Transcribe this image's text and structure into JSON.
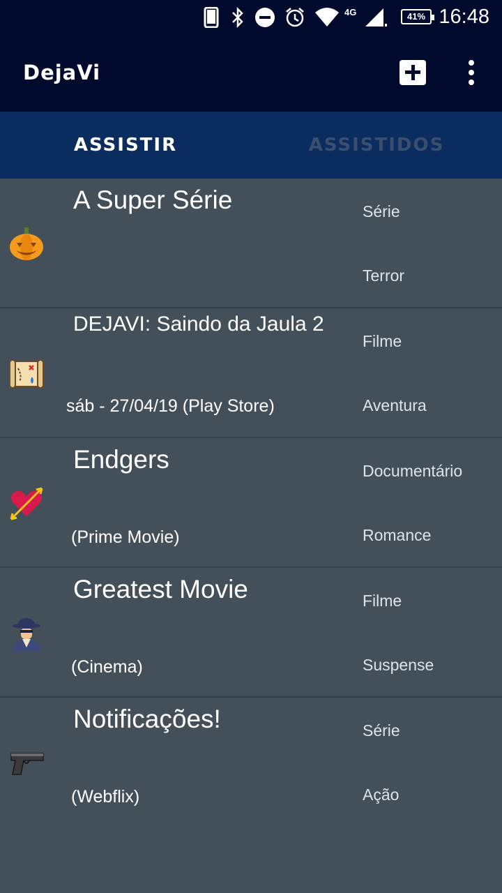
{
  "status_bar": {
    "time": "16:48",
    "battery": "41%",
    "network": "4G",
    "icons": [
      "phone-icon",
      "bluetooth-icon",
      "dnd-icon",
      "alarm-icon",
      "wifi-icon",
      "signal-icon"
    ]
  },
  "app_bar": {
    "title": "DejaVi",
    "actions": [
      "add-icon",
      "more-vert-icon"
    ]
  },
  "tabs": [
    {
      "label": "ASSISTIR",
      "active": true
    },
    {
      "label": "ASSISTIDOS",
      "active": false
    }
  ],
  "items": [
    {
      "title": "A Super Série",
      "subtitle": "",
      "type": "Série",
      "genre": "Terror",
      "icon": "pumpkin-icon"
    },
    {
      "title": "DEJAVI: Saindo da Jaula 2",
      "subtitle": "sáb - 27/04/19 (Play Store)",
      "type": "Filme",
      "genre": "Aventura",
      "icon": "treasure-map-icon"
    },
    {
      "title": "Endgers",
      "subtitle": "(Prime Movie)",
      "type": "Documentário",
      "genre": "Romance",
      "icon": "heart-arrow-icon"
    },
    {
      "title": "Greatest Movie",
      "subtitle": "(Cinema)",
      "type": "Filme",
      "genre": "Suspense",
      "icon": "detective-icon"
    },
    {
      "title": "Notificações!",
      "subtitle": "(Webflix)",
      "type": "Série",
      "genre": "Ação",
      "icon": "pistol-icon"
    }
  ],
  "colors": {
    "app_bar": "#000a2c",
    "tab_bar": "#0b2c5e",
    "list_bg": "#445059",
    "tab_inactive": "#3a4f6d"
  }
}
